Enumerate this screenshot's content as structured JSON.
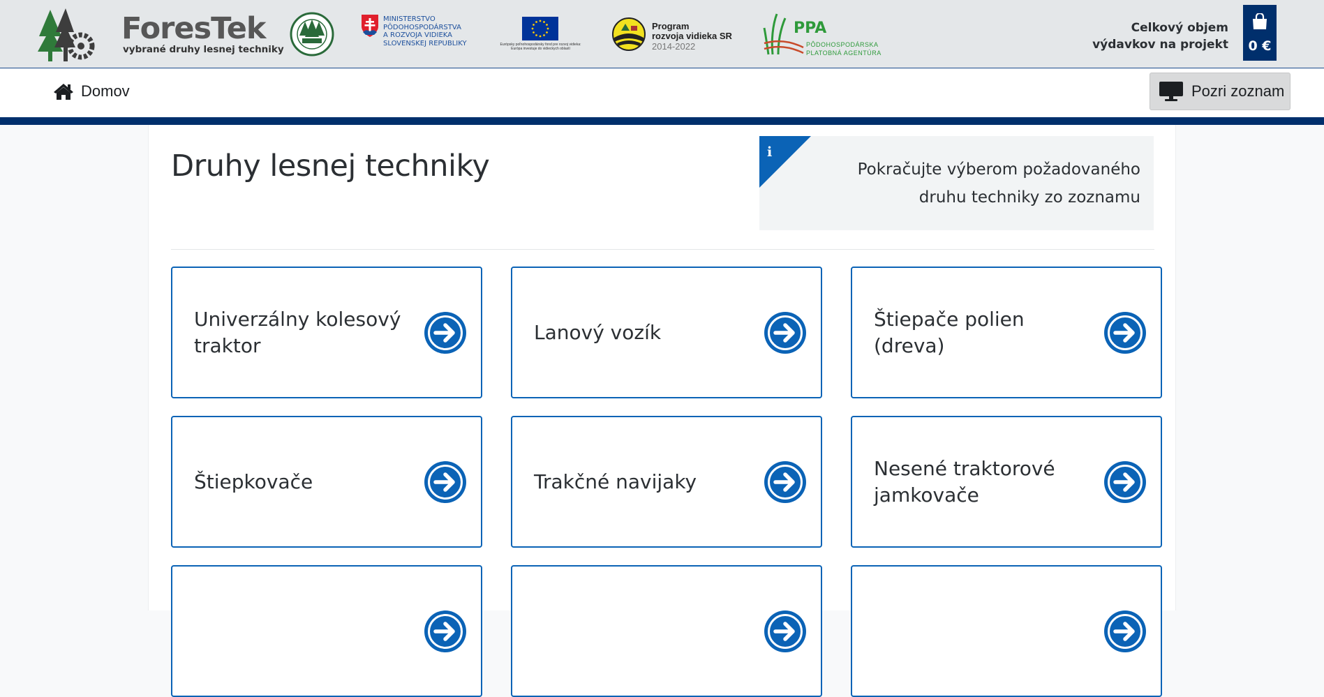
{
  "header": {
    "brand_name": "ForesTek",
    "brand_tagline": "vybrané druhy lesnej techniky",
    "ministry_lines": [
      "Ministerstvo",
      "pôdohospodárstva",
      "a rozvoja vidieka",
      "Slovenskej republiky"
    ],
    "eu_caption": "Európsky poľnohospodársky fond pre rozvoj vidieka: Európa investuje do vidieckych oblastí",
    "prv_lines": [
      "Program",
      "rozvoja vidieka SR"
    ],
    "prv_years": "2014-2022",
    "ppa_abbr": "PPA",
    "ppa_lines": [
      "Pôdohospodárska",
      "platobná agentúra"
    ],
    "cart_label_line1": "Celkový objem",
    "cart_label_line2": "výdavkov na projekt",
    "cart_amount": "0 €",
    "colors": {
      "navy": "#002f6c",
      "accent": "#0b63b6",
      "green": "#2e9a3a"
    }
  },
  "nav": {
    "home_label": "Domov",
    "home_icon": "home-icon",
    "list_button_label": "Pozri zoznam",
    "list_icon": "monitor-icon"
  },
  "main": {
    "title": "Druhy lesnej techniky",
    "info_text": "Pokračujte výberom požadovaného druhu techniky zo zoznamu",
    "cards": [
      {
        "label": "Univerzálny kolesový traktor"
      },
      {
        "label": "Lanový vozík"
      },
      {
        "label": "Štiepače polien (dreva)"
      },
      {
        "label": "Štiepkovače"
      },
      {
        "label": "Trakčné navijaky"
      },
      {
        "label": "Nesené traktorové jamkovače"
      },
      {
        "label": ""
      },
      {
        "label": ""
      },
      {
        "label": ""
      }
    ]
  }
}
